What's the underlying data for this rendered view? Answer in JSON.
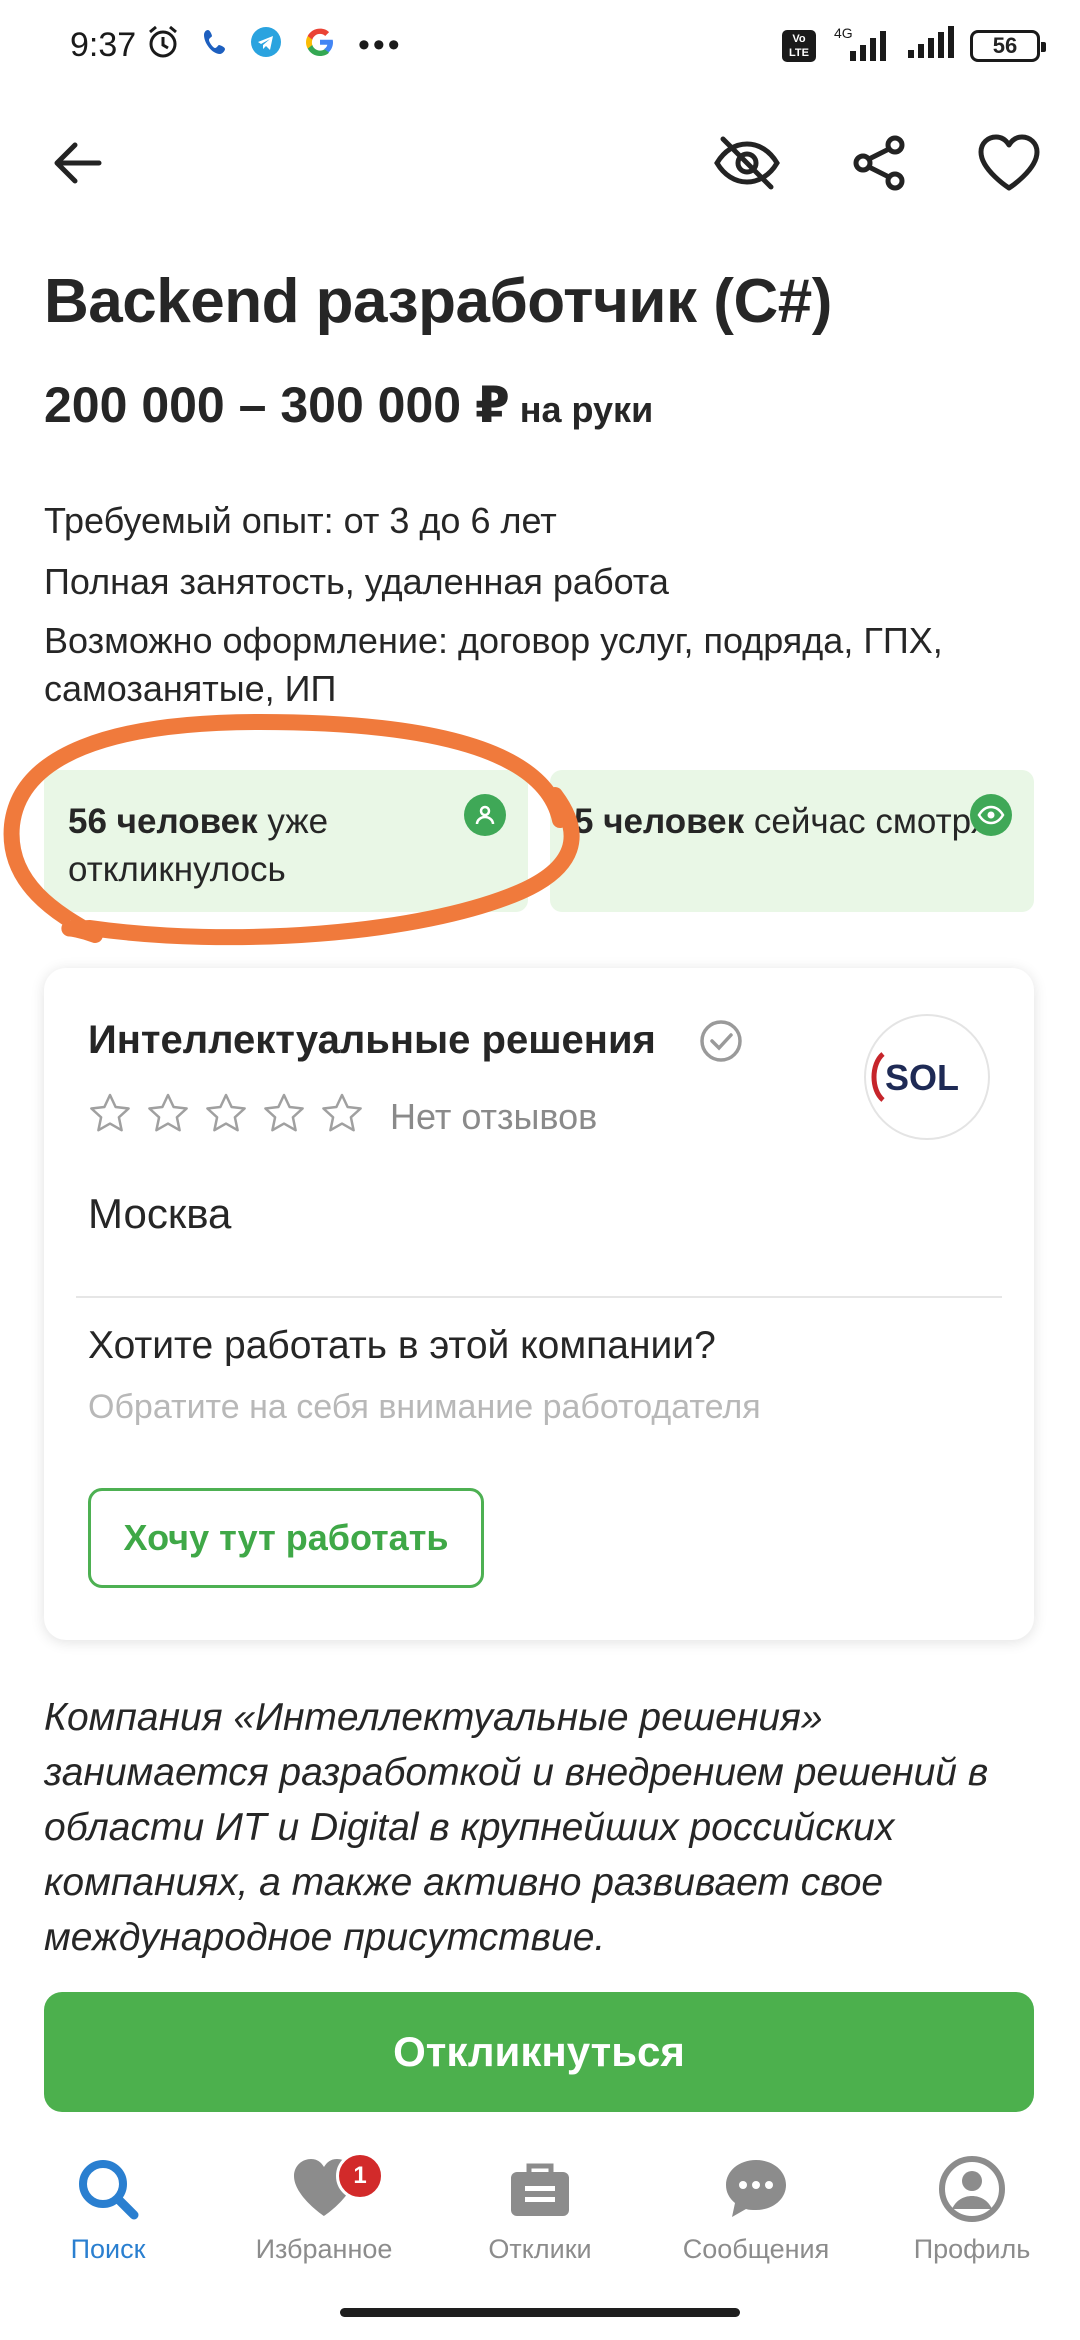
{
  "status_bar": {
    "time": "9:37",
    "battery": "56",
    "network_label": "4G",
    "volte_label": "Vo LTE"
  },
  "job": {
    "title": "Backend разработчик (C#)",
    "salary": "200 000 – 300 000 ₽",
    "salary_note": "на руки",
    "experience": "Требуемый опыт: от 3 до 6 лет",
    "employment": "Полная занятость, удаленная работа",
    "contract": "Возможно оформление: договор услуг, подряда, ГПХ, самозанятые, ИП"
  },
  "stats": {
    "applied_count": "56 человек",
    "applied_text": "уже откликнулось",
    "viewing_count": "5 человек",
    "viewing_text": "сейчас смотрят"
  },
  "company": {
    "name": "Интеллектуальные решения",
    "reviews_label": "Нет отзывов",
    "rating_stars": 0,
    "city": "Москва",
    "logo_text": "SOL",
    "want_title": "Хотите работать в этой компании?",
    "want_subtitle": "Обратите на себя внимание работодателя",
    "want_button": "Хочу тут работать"
  },
  "description": "Компания «Интеллектуальные решения» занимается разработкой и внедрением решений в области ИТ и Digital в крупнейших российских компаниях, а также активно развивает свое международное присутствие.",
  "apply_button": "Откликнуться",
  "nav": {
    "items": [
      {
        "label": "Поиск",
        "icon": "search-icon",
        "active": true
      },
      {
        "label": "Избранное",
        "icon": "heart-icon",
        "badge": "1"
      },
      {
        "label": "Отклики",
        "icon": "briefcase-icon"
      },
      {
        "label": "Сообщения",
        "icon": "chat-icon"
      },
      {
        "label": "Профиль",
        "icon": "profile-icon"
      }
    ]
  },
  "colors": {
    "accent_green": "#4cb04d",
    "stat_bg": "#e9f7e6",
    "nav_active": "#2a7fd0",
    "badge_red": "#d22a2a",
    "annotation_orange": "#f07a3c"
  }
}
